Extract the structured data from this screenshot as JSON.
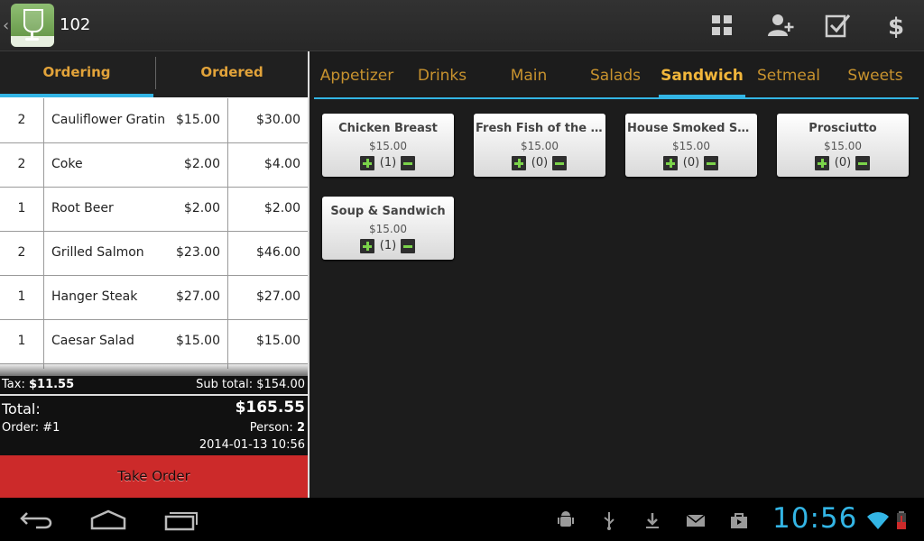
{
  "header": {
    "table_number": "102",
    "icons": [
      "grid-icon",
      "add-person-icon",
      "checklist-icon",
      "dollar-icon"
    ]
  },
  "order_tabs": [
    "Ordering",
    "Ordered"
  ],
  "order_items": [
    {
      "qty": "2",
      "name": "Cauliflower Gratin",
      "price": "$15.00",
      "total": "$30.00"
    },
    {
      "qty": "2",
      "name": "Coke",
      "price": "$2.00",
      "total": "$4.00"
    },
    {
      "qty": "1",
      "name": "Root Beer",
      "price": "$2.00",
      "total": "$2.00"
    },
    {
      "qty": "2",
      "name": "Grilled Salmon",
      "price": "$23.00",
      "total": "$46.00"
    },
    {
      "qty": "1",
      "name": "Hanger Steak",
      "price": "$27.00",
      "total": "$27.00"
    },
    {
      "qty": "1",
      "name": "Caesar Salad",
      "price": "$15.00",
      "total": "$15.00"
    }
  ],
  "summary": {
    "tax_label": "Tax:",
    "tax_value": "$11.55",
    "subtotal": "Sub total: $154.00",
    "total_label": "Total:",
    "total_value": "$165.55",
    "order_label": "Order: #1",
    "person_label": "Person:",
    "person_value": "2",
    "datetime": "2014-01-13 10:56"
  },
  "take_order_label": "Take Order",
  "categories": [
    "Appetizer",
    "Drinks",
    "Main",
    "Salads",
    "Sandwich",
    "Setmeal",
    "Sweets"
  ],
  "selected_category": "Sandwich",
  "menu_items": [
    {
      "name": "Chicken Breast",
      "price": "$15.00",
      "qty": "(1)"
    },
    {
      "name": "Fresh Fish of the Day",
      "price": "$15.00",
      "qty": "(0)"
    },
    {
      "name": "House Smoked Salm...",
      "price": "$15.00",
      "qty": "(0)"
    },
    {
      "name": "Prosciutto",
      "price": "$15.00",
      "qty": "(0)"
    },
    {
      "name": "Soup & Sandwich",
      "price": "$15.00",
      "qty": "(1)"
    }
  ],
  "status_bar": {
    "clock": "10:56"
  },
  "colors": {
    "accent": "#33b5e5",
    "tab_text": "#c7922e",
    "take_order_bg": "#cc2a2a"
  }
}
